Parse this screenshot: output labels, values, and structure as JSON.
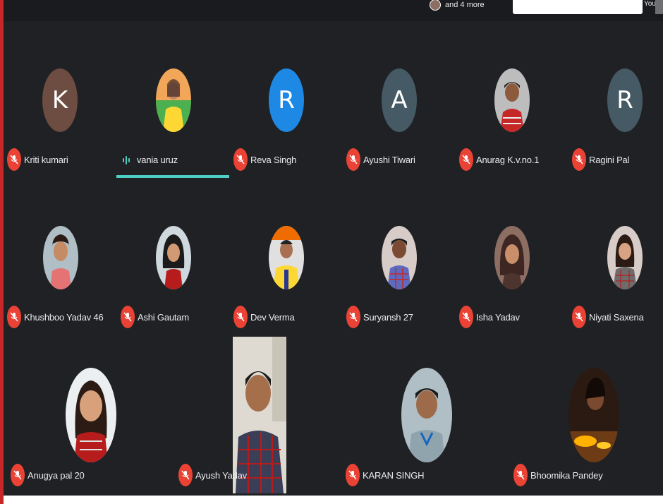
{
  "topbar": {
    "more_text": "and 4 more",
    "you_label": "You"
  },
  "participants": [
    {
      "name": "Kriti kumari",
      "initial": "K",
      "bg": "#6d4c41",
      "muted": true
    },
    {
      "name": "vania uruz",
      "initial": "",
      "bg": "#e8a040",
      "muted": false,
      "speaking": true
    },
    {
      "name": "Reva Singh",
      "initial": "R",
      "bg": "#1e88e5",
      "muted": true
    },
    {
      "name": "Ayushi Tiwari",
      "initial": "A",
      "bg": "#455a64",
      "muted": true
    },
    {
      "name": "Anurag K.v.no.1",
      "initial": "",
      "bg": "#9e9e9e",
      "muted": true
    },
    {
      "name": "Ragini Pal",
      "initial": "R",
      "bg": "#455a64",
      "muted": true
    },
    {
      "name": "Khushboo Yadav 46",
      "initial": "",
      "bg": "#b0bec5",
      "muted": true
    },
    {
      "name": "Ashi Gautam",
      "initial": "",
      "bg": "#cfd8dc",
      "muted": true
    },
    {
      "name": "Dev Verma",
      "initial": "",
      "bg": "#f9a825",
      "muted": true
    },
    {
      "name": "Suryansh 27",
      "initial": "",
      "bg": "#a1887f",
      "muted": true
    },
    {
      "name": "Isha Yadav",
      "initial": "",
      "bg": "#8d6e63",
      "muted": true
    },
    {
      "name": "Niyati Saxena",
      "initial": "",
      "bg": "#d7ccc8",
      "muted": true
    },
    {
      "name": "Anugya pal 20",
      "initial": "",
      "bg": "#eceff1",
      "muted": true
    },
    {
      "name": "Ayush Yadav",
      "initial": "",
      "bg": "#d9d6d0",
      "muted": true,
      "video": true
    },
    {
      "name": "KARAN SINGH",
      "initial": "",
      "bg": "#b0bec5",
      "muted": true
    },
    {
      "name": "Bhoomika Pandey",
      "initial": "",
      "bg": "#4e342e",
      "muted": true
    }
  ],
  "colors": {
    "stage": "#202124",
    "mic_muted": "#ea4335",
    "speaking": "#4ecdc4"
  },
  "icons": {
    "muted": "mic-off-icon",
    "speaking": "audio-level-icon"
  }
}
